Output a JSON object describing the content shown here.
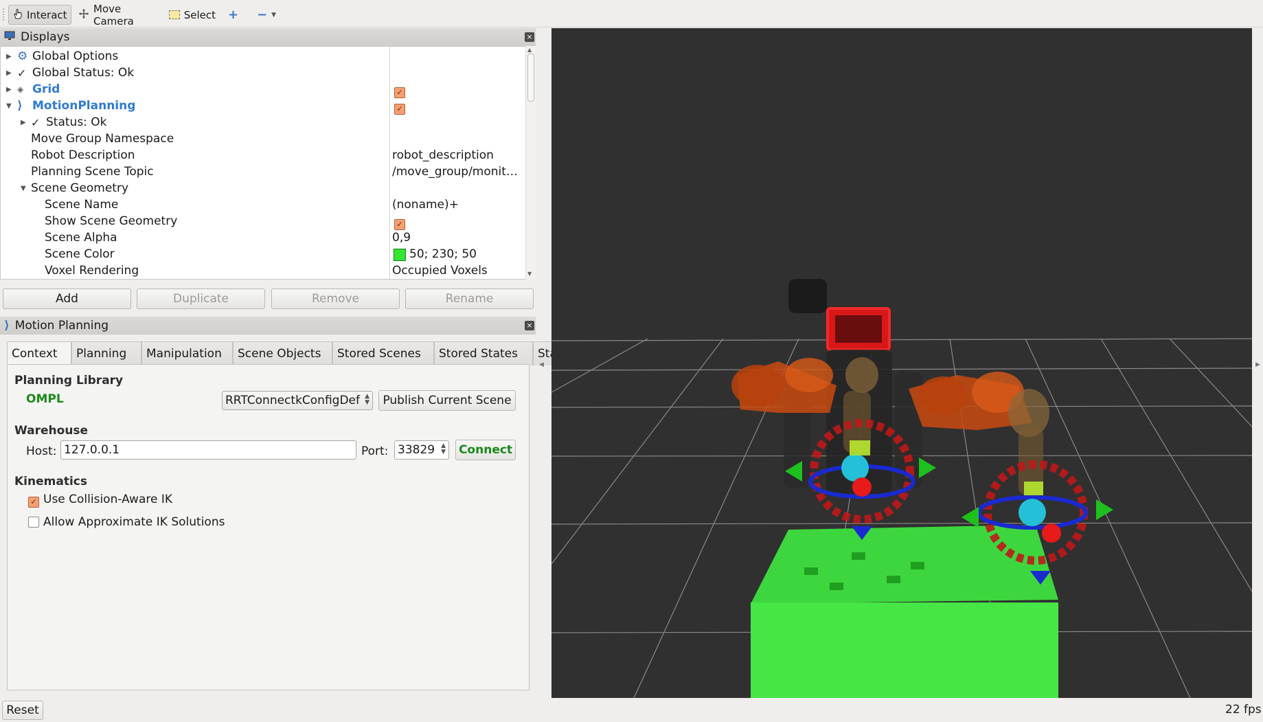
{
  "toolbar": {
    "interact": "Interact",
    "move_camera": "Move Camera",
    "select": "Select"
  },
  "displays_panel": {
    "title": "Displays",
    "rows": [
      {
        "label": "Global Options",
        "value": ""
      },
      {
        "label": "Global Status: Ok",
        "value": ""
      },
      {
        "label": "Grid",
        "value": ""
      },
      {
        "label": "MotionPlanning",
        "value": ""
      },
      {
        "label": "Status: Ok",
        "value": ""
      },
      {
        "label": "Move Group Namespace",
        "value": ""
      },
      {
        "label": "Robot Description",
        "value": "robot_description"
      },
      {
        "label": "Planning Scene Topic",
        "value": "/move_group/monit…"
      },
      {
        "label": "Scene Geometry",
        "value": ""
      },
      {
        "label": "Scene Name",
        "value": "(noname)+"
      },
      {
        "label": "Show Scene Geometry",
        "value": ""
      },
      {
        "label": "Scene Alpha",
        "value": "0,9"
      },
      {
        "label": "Scene Color",
        "value": "50; 230; 50"
      },
      {
        "label": "Voxel Rendering",
        "value": "Occupied Voxels"
      }
    ],
    "scene_color_swatch": "#32e632",
    "buttons": {
      "add": "Add",
      "duplicate": "Duplicate",
      "remove": "Remove",
      "rename": "Rename"
    }
  },
  "motion_planning_panel": {
    "title": "Motion Planning",
    "tabs": [
      "Context",
      "Planning",
      "Manipulation",
      "Scene Objects",
      "Stored Scenes",
      "Stored States",
      "Status"
    ],
    "planning_library": {
      "heading": "Planning Library",
      "library_name": "OMPL",
      "planner": "RRTConnectkConfigDef",
      "publish_button": "Publish Current Scene"
    },
    "warehouse": {
      "heading": "Warehouse",
      "host_label": "Host:",
      "host_value": "127.0.0.1",
      "port_label": "Port:",
      "port_value": "33829",
      "connect_button": "Connect"
    },
    "kinematics": {
      "heading": "Kinematics",
      "collision_aware_ik": {
        "label": "Use Collision-Aware IK",
        "checked": true
      },
      "approximate_ik": {
        "label": "Allow Approximate IK Solutions",
        "checked": false
      }
    }
  },
  "status_bar": {
    "reset_button": "Reset",
    "fps": "22 fps"
  }
}
